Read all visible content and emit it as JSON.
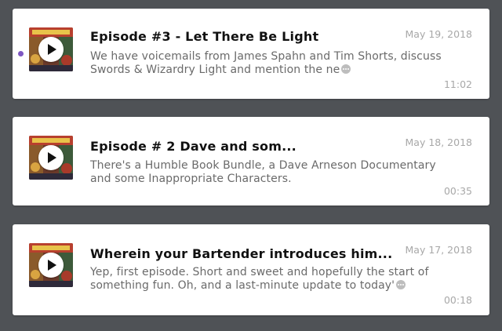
{
  "colors": {
    "background": "#4f5256",
    "card": "#ffffff",
    "unplayed_indicator": "#7e57c2",
    "meta_text": "#a8a8a8"
  },
  "episodes": [
    {
      "title": "Episode #3 - Let There Be Light",
      "date": "May 19, 2018",
      "description": "We have voicemails from James Spahn and Tim Shorts, discuss Swords & Wizardry Light and mention the ne",
      "duration": "11:02",
      "unplayed": true,
      "artwork_icon": "podcast-artwork-icon",
      "play_icon": "play-icon",
      "more_icon": "ellipsis-icon"
    },
    {
      "title": "Episode # 2 Dave and som...",
      "date": "May 18, 2018",
      "description": "There's a Humble Book Bundle, a Dave Arneson Documentary and some Inappropriate Characters.",
      "duration": "00:35",
      "unplayed": false,
      "artwork_icon": "podcast-artwork-icon",
      "play_icon": "play-icon"
    },
    {
      "title": "Wherein your Bartender introduces him...",
      "date": "May 17, 2018",
      "description": "Yep, first episode. Short and sweet and hopefully the start of something fun. Oh, and a last-minute update to today'",
      "duration": "00:18",
      "unplayed": false,
      "artwork_icon": "podcast-artwork-icon",
      "play_icon": "play-icon",
      "more_icon": "ellipsis-icon"
    }
  ]
}
